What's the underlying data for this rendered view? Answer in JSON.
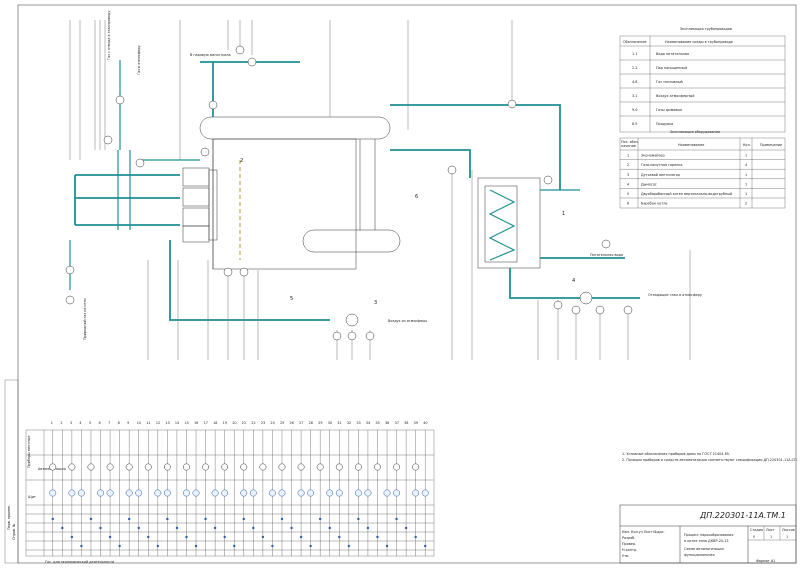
{
  "margin": {
    "left_text_1": "Перв. примен.",
    "left_text_2": "Справ. №"
  },
  "labels": {
    "to_steam_header": "В паровую магистраль",
    "feed_water": "Питательная вода",
    "flue_gas": "Отходящие газы в атмосферу",
    "air_from_atm": "Воздух из атмосферы",
    "gas_from_network": "Природный газ из сети",
    "to_atmosphere": "Газ в атмосферу",
    "gas_from_grp": "Газ с отвода к газопроводу"
  },
  "positions": {
    "p1": "1",
    "p2": "2",
    "p3": "3",
    "p4": "4",
    "p5": "5",
    "p6": "6"
  },
  "pipe_legend": {
    "title": "Экспликация трубопроводов",
    "col_code": "Обозначение",
    "col_medium": "Наименование среды в трубопроводе",
    "rows": [
      {
        "code": "1.1",
        "medium": "Вода питательная"
      },
      {
        "code": "2.2",
        "medium": "Пар насыщенный"
      },
      {
        "code": "4.8",
        "medium": "Газ топливный"
      },
      {
        "code": "3.1",
        "medium": "Воздух атмосферный"
      },
      {
        "code": "9.0",
        "medium": "Газы дымовые"
      },
      {
        "code": "8.9",
        "medium": "Продувка"
      }
    ]
  },
  "equip_legend": {
    "title": "Экспликация оборудования",
    "col_pos_1": "Поз. обоз-",
    "col_pos_2": "начение",
    "col_name": "Наименование",
    "col_qty": "Кол.",
    "col_note": "Примечание",
    "rows": [
      {
        "pos": "1",
        "name": "Экономайзер",
        "qty": "1"
      },
      {
        "pos": "2",
        "name": "Газо-мазутная горелка",
        "qty": "4"
      },
      {
        "pos": "3",
        "name": "Дутьевой вентилятор",
        "qty": "1"
      },
      {
        "pos": "4",
        "name": "Дымосос",
        "qty": "1"
      },
      {
        "pos": "5",
        "name": "Двухбарабанный котел вертикально-водотрубный",
        "qty": "1"
      },
      {
        "pos": "6",
        "name": "Барабан котла",
        "qty": "2"
      }
    ]
  },
  "notes": {
    "n1": "1. Условные обозначения приборов даны по ГОСТ 21404-85.",
    "n2": "2. Позиции приборов и средств автоматизации соответствуют спецификации ДП.220301-11А.СП."
  },
  "instr_table": {
    "row_local": "Приборы местные",
    "row_auto": "Автоматизация",
    "row_panel": "Щит",
    "columns": [
      "1",
      "2",
      "3",
      "4",
      "5",
      "6",
      "7",
      "8",
      "9",
      "10",
      "11",
      "12",
      "13",
      "14",
      "15",
      "16",
      "17",
      "18",
      "19",
      "20",
      "21",
      "22",
      "23",
      "24",
      "25",
      "26",
      "27",
      "28",
      "29",
      "30",
      "31",
      "32",
      "33",
      "34",
      "35",
      "36",
      "37",
      "38",
      "39",
      "40"
    ]
  },
  "title_block": {
    "code": "ДП.220301-11А.ТМ.1",
    "title_1": "Процесс пароообразования",
    "title_2": "в котле типа ДКВР-20-13",
    "title_3": "Схема автоматизации",
    "title_4": "функциональная",
    "stage_label": "Стадия",
    "sheet_label": "Лист",
    "sheets_label": "Листов",
    "stage": "У",
    "sheet": "1",
    "sheets": "1",
    "roles": [
      "Изм. Кол.уч Лист №док.",
      "Разраб.",
      "Провер.",
      "Н.контр.",
      "Утв."
    ],
    "format": "Формат А1"
  },
  "footer": {
    "note": "Гос. для экономической деятельности"
  }
}
